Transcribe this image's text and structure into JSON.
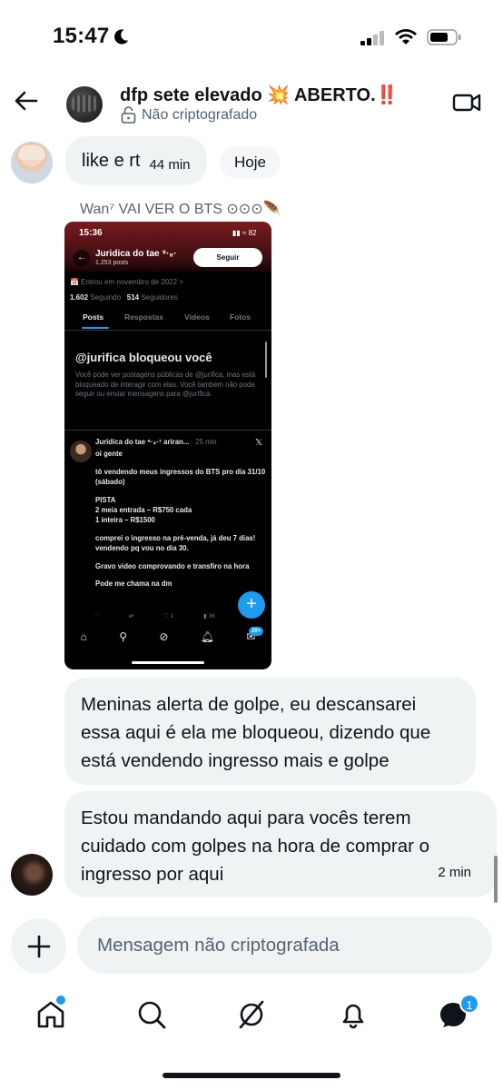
{
  "status_bar": {
    "time": "15:47"
  },
  "header": {
    "title": "dfp sete elevado 💥 ABERTO.‼️",
    "encryption": "Não criptografado"
  },
  "messages": [
    {
      "text": "like e rt",
      "time": "44 min"
    },
    {
      "reply_label": "Wan⁷ VAI VER O BTS ⊙⊙⊙🪶"
    },
    {
      "text": "Meninas alerta de golpe, eu descansarei essa aqui é ela me bloqueou, dizendo que está vendendo ingresso mais e golpe"
    },
    {
      "text": "Estou mandando aqui para vocês terem cuidado com golpes na hora de comprar o ingresso por aqui",
      "time": "2 min"
    }
  ],
  "date_pill": "Hoje",
  "embedded_screenshot": {
    "time": "15:36",
    "status_icons": "▮▮ ≈ 82",
    "profile_name": "Juridica do tae ⁹·₈·",
    "posts_count": "1.253 posts",
    "follow_label": "Seguir",
    "joined": "📅 Entrou em novembro de 2022 >",
    "following_count": "1.602",
    "following_label": "Seguindo",
    "followers_count": "514",
    "followers_label": "Seguidores",
    "tabs": [
      "Posts",
      "Respostas",
      "Vídeos",
      "Fotos"
    ],
    "blocked_title": "@jurifica bloqueou você",
    "blocked_desc": "Você pode ver postagens públicas de @jurifica, mas está bloqueado de interagir com elas. Você também não pode seguir ou enviar mensagens para @jurifica.",
    "tweet_author": "Juridica do tae ⁹·₈·⁷ ariran...",
    "tweet_time": "· 25 min",
    "tweet_paragraphs": [
      "oi gente",
      "tô vendendo meus ingressos do BTS pro dia 31/10 (sábado)",
      "PISTA\n2 meia entrada – R$750 cada\n1 inteira – R$1500",
      "comprei o ingresso na pré-venda, já deu 7 dias! vendendo pq vou no dia 30.",
      "Gravo video comprovando e transfiro na hora",
      "Pode me chama na dm"
    ],
    "tweet_likes": "1",
    "tweet_views": "36",
    "nav_badge": "20+"
  },
  "composer": {
    "placeholder": "Mensagem não criptografada"
  },
  "bottom_nav": {
    "messages_badge": "1"
  },
  "colors": {
    "accent": "#1d9bf0",
    "bubble": "#eff3f4",
    "text": "#0f1419",
    "muted": "#536471"
  }
}
